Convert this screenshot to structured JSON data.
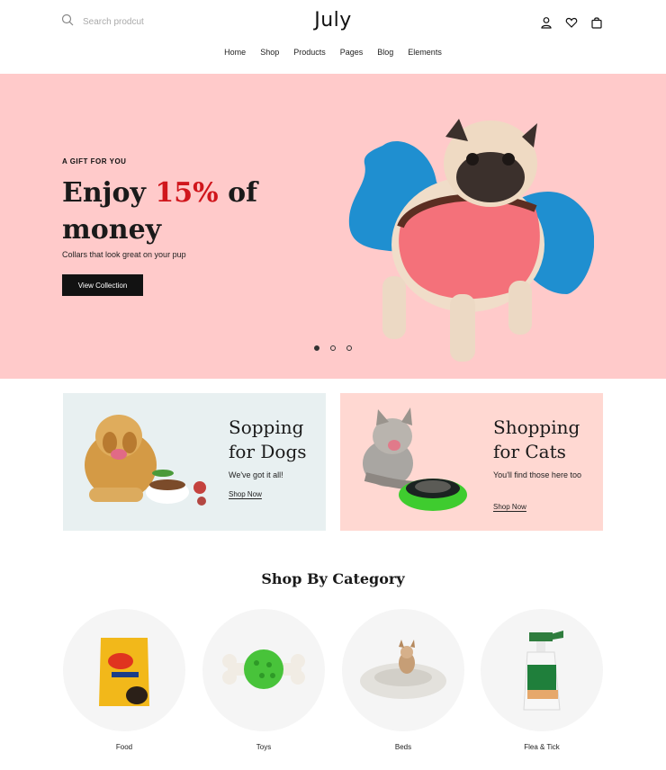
{
  "header": {
    "search_placeholder": "Search prodcut",
    "logo": "July",
    "nav": [
      "Home",
      "Shop",
      "Products",
      "Pages",
      "Blog",
      "Elements"
    ],
    "icons": [
      "search-icon",
      "user-icon",
      "heart-icon",
      "bag-icon"
    ]
  },
  "hero": {
    "eyebrow": "A GIFT FOR YOU",
    "title_pre": "Enjoy ",
    "title_accent": "15%",
    "title_post": " of money",
    "subtitle": "Collars that look great on your pup",
    "button": "View Collection",
    "slides": 3,
    "active_slide": 1,
    "background": "#ffcaca",
    "accent_color": "#d0161c",
    "blob_color": "#1f8fd0"
  },
  "promos": [
    {
      "title": "Sopping for Dogs",
      "line1": "Sopping",
      "line2": "for Dogs",
      "subtitle": "We've got it all!",
      "link": "Shop Now",
      "background": "#e8f0f1"
    },
    {
      "title": "Shopping for Cats",
      "line1": "Shopping",
      "line2": "for Cats",
      "subtitle": "You'll find those here too",
      "link": "Shop Now",
      "background": "#ffd8d2"
    }
  ],
  "categories": {
    "heading": "Shop By Category",
    "items": [
      {
        "label": "Food"
      },
      {
        "label": "Toys"
      },
      {
        "label": "Beds"
      },
      {
        "label": "Flea & Tick"
      }
    ]
  }
}
